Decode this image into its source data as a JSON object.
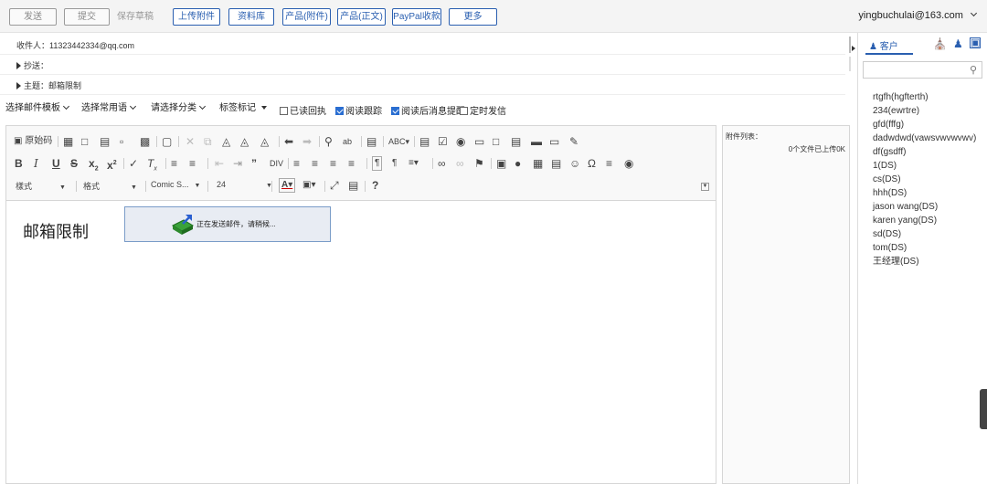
{
  "toolbar": {
    "send": "发送",
    "submit": "提交",
    "save_draft": "保存草稿",
    "upload": "上传附件",
    "library": "资料库",
    "product_attach": "产品(附件)",
    "product_body": "产品(正文)",
    "paypal": "PayPal收款",
    "more": "更多"
  },
  "user": {
    "email": "yingbuchulai@163.com"
  },
  "compose": {
    "to_label": "收件人：",
    "to_value": "11323442334@qq.com",
    "cc_label": "抄送：",
    "subject_label": "主题：",
    "subject_value": "邮箱限制"
  },
  "options": {
    "template": "选择邮件模板",
    "phrases": "选择常用语",
    "category": "请选择分类",
    "tag": "标签标记",
    "read_receipt": "已读回执",
    "read_receipt_checked": false,
    "read_tracking": "阅读跟踪",
    "read_tracking_checked": true,
    "read_remind": "阅读后消息提醒",
    "read_remind_checked": true,
    "scheduled": "定时发信",
    "scheduled_checked": false
  },
  "editor": {
    "source_label": "原始码",
    "style_combo": "樣式",
    "format_combo": "格式",
    "font_combo": "Comic S...",
    "size_combo": "24",
    "body_title": "邮箱限制",
    "sending_msg": "正在发送邮件，请稍候..."
  },
  "attachments": {
    "label": "附件列表：",
    "status": "0个文件已上传0K"
  },
  "right_panel": {
    "tab_customer": "客户",
    "contacts": [
      "rtgfh(hgfterth)",
      "234(ewrtre)",
      "gfd(fffg)",
      "dadwdwd(vawsvwvwvwv)",
      "df(gsdff)",
      "1(DS)",
      "cs(DS)",
      "hhh(DS)",
      "jason wang(DS)",
      "karen yang(DS)",
      "sd(DS)",
      "tom(DS)",
      "王经理(DS)"
    ]
  }
}
